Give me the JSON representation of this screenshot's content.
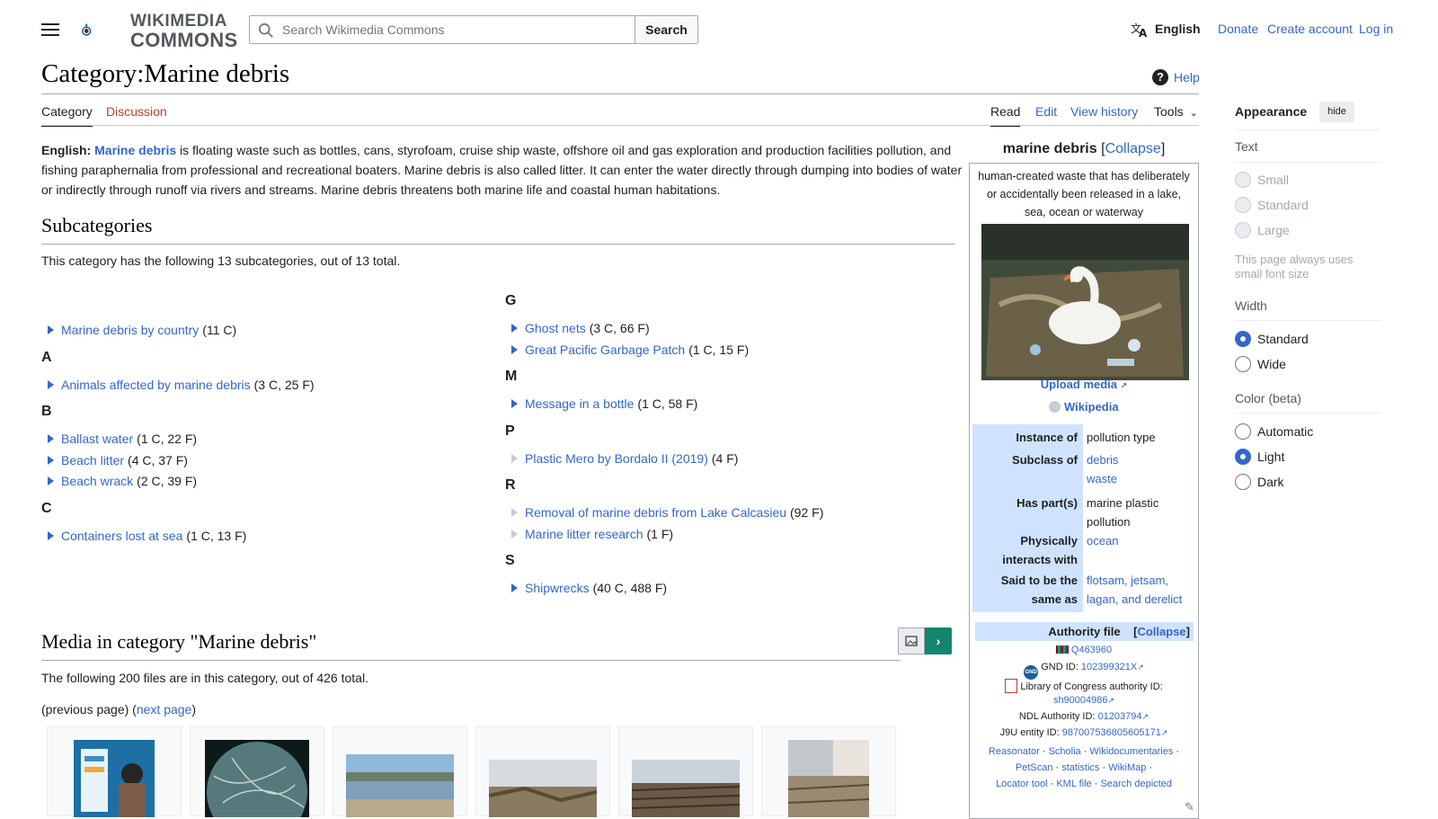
{
  "header": {
    "logo_line1": "WIKIMEDIA",
    "logo_line2": "COMMONS",
    "search_placeholder": "Search Wikimedia Commons",
    "search_button": "Search",
    "language": "English",
    "links": [
      "Donate",
      "Create account",
      "Log in"
    ]
  },
  "page": {
    "title": "Category:Marine debris",
    "help": "Help",
    "tabs_left": [
      "Category",
      "Discussion"
    ],
    "tabs_right": [
      "Read",
      "Edit",
      "View history",
      "Tools"
    ]
  },
  "intro": {
    "lang_label": "English:",
    "link": "Marine debris",
    "text": " is floating waste such as bottles, cans, styrofoam, cruise ship waste, offshore oil and gas exploration and production facilities pollution, and fishing paraphernalia from professional and recreational boaters. Marine debris is also called litter. It can enter the water directly through dumping into bodies of water or indirectly through runoff via rivers and streams. Marine debris threatens both marine life and coastal human habitations."
  },
  "subcategories": {
    "heading": "Subcategories",
    "summary": "This category has the following 13 subcategories, out of 13 total.",
    "col1": [
      {
        "name": "Marine debris by country",
        "count": "(11 C)",
        "expandable": true
      },
      {
        "letter": "A"
      },
      {
        "name": "Animals affected by marine debris",
        "count": "(3 C, 25 F)",
        "expandable": true
      },
      {
        "letter": "B"
      },
      {
        "name": "Ballast water",
        "count": "(1 C, 22 F)",
        "expandable": true
      },
      {
        "name": "Beach litter",
        "count": "(4 C, 37 F)",
        "expandable": true
      },
      {
        "name": "Beach wrack",
        "count": "(2 C, 39 F)",
        "expandable": true
      },
      {
        "letter": "C"
      },
      {
        "name": "Containers lost at sea",
        "count": "(1 C, 13 F)",
        "expandable": true
      }
    ],
    "col2": [
      {
        "letter": "G"
      },
      {
        "name": "Ghost nets",
        "count": "(3 C, 66 F)",
        "expandable": true
      },
      {
        "name": "Great Pacific Garbage Patch",
        "count": "(1 C, 15 F)",
        "expandable": true
      },
      {
        "letter": "M"
      },
      {
        "name": "Message in a bottle",
        "count": "(1 C, 58 F)",
        "expandable": true
      },
      {
        "letter": "P"
      },
      {
        "name": "Plastic Mero by Bordalo II (2019)",
        "count": "(4 F)",
        "expandable": false
      },
      {
        "letter": "R"
      },
      {
        "name": "Removal of marine debris from Lake Calcasieu",
        "count": "(92 F)",
        "expandable": false
      },
      {
        "name": "Marine litter research",
        "count": "(1 F)",
        "expandable": false
      },
      {
        "letter": "S"
      },
      {
        "name": "Shipwrecks",
        "count": "(40 C, 488 F)",
        "expandable": true
      }
    ]
  },
  "media": {
    "heading": "Media in category \"Marine debris\"",
    "summary": "The following 200 files are in this category, out of 426 total.",
    "prev": "(previous page)",
    "next": "next page"
  },
  "infobox": {
    "title": "marine debris",
    "collapse": "Collapse",
    "description": "human-created waste that has deliberately or accidentally been released in a lake, sea, ocean or waterway",
    "upload": "Upload media",
    "wikipedia": "Wikipedia",
    "rows": [
      {
        "key": "Instance of",
        "values": [
          "pollution type"
        ],
        "links": false
      },
      {
        "key": "Subclass of",
        "values": [
          "debris",
          "waste"
        ],
        "links": true
      },
      {
        "key": "Has part(s)",
        "values": [
          "marine plastic pollution"
        ],
        "links": false
      },
      {
        "key": "Physically interacts with",
        "values": [
          "ocean"
        ],
        "links": true
      },
      {
        "key": "Said to be the same as",
        "values": [
          "flotsam, jetsam, lagan, and derelict"
        ],
        "links": true
      }
    ],
    "authority_title": "Authority file",
    "authority_collapse": "Collapse",
    "wikidata_id": "Q463960",
    "gnd_label": "GND ID:",
    "gnd_id": "102399321X",
    "loc_label": "Library of Congress authority ID:",
    "loc_id": "sh90004986",
    "ndl_label": "NDL Authority ID:",
    "ndl_id": "01203794",
    "j9u_label": "J9U entity ID:",
    "j9u_id": "987007536805605171",
    "tools_line1": [
      "Reasonator",
      "Scholia",
      "Wikidocumentaries"
    ],
    "tools_line2": [
      "PetScan",
      "statistics",
      "WikiMap"
    ],
    "tools_line3": [
      "Locator tool",
      "KML file",
      "Search depicted"
    ]
  },
  "appearance": {
    "title": "Appearance",
    "hide": "hide",
    "text_head": "Text",
    "text_options": [
      "Small",
      "Standard",
      "Large"
    ],
    "text_note": "This page always uses small font size",
    "width_head": "Width",
    "width_options": [
      "Standard",
      "Wide"
    ],
    "width_selected": "Standard",
    "color_head": "Color (beta)",
    "color_options": [
      "Automatic",
      "Light",
      "Dark"
    ],
    "color_selected": "Light"
  },
  "colors": {
    "link": "#3366cc",
    "infobox_key": "#cfe3ff",
    "green_button": "#14866d"
  }
}
